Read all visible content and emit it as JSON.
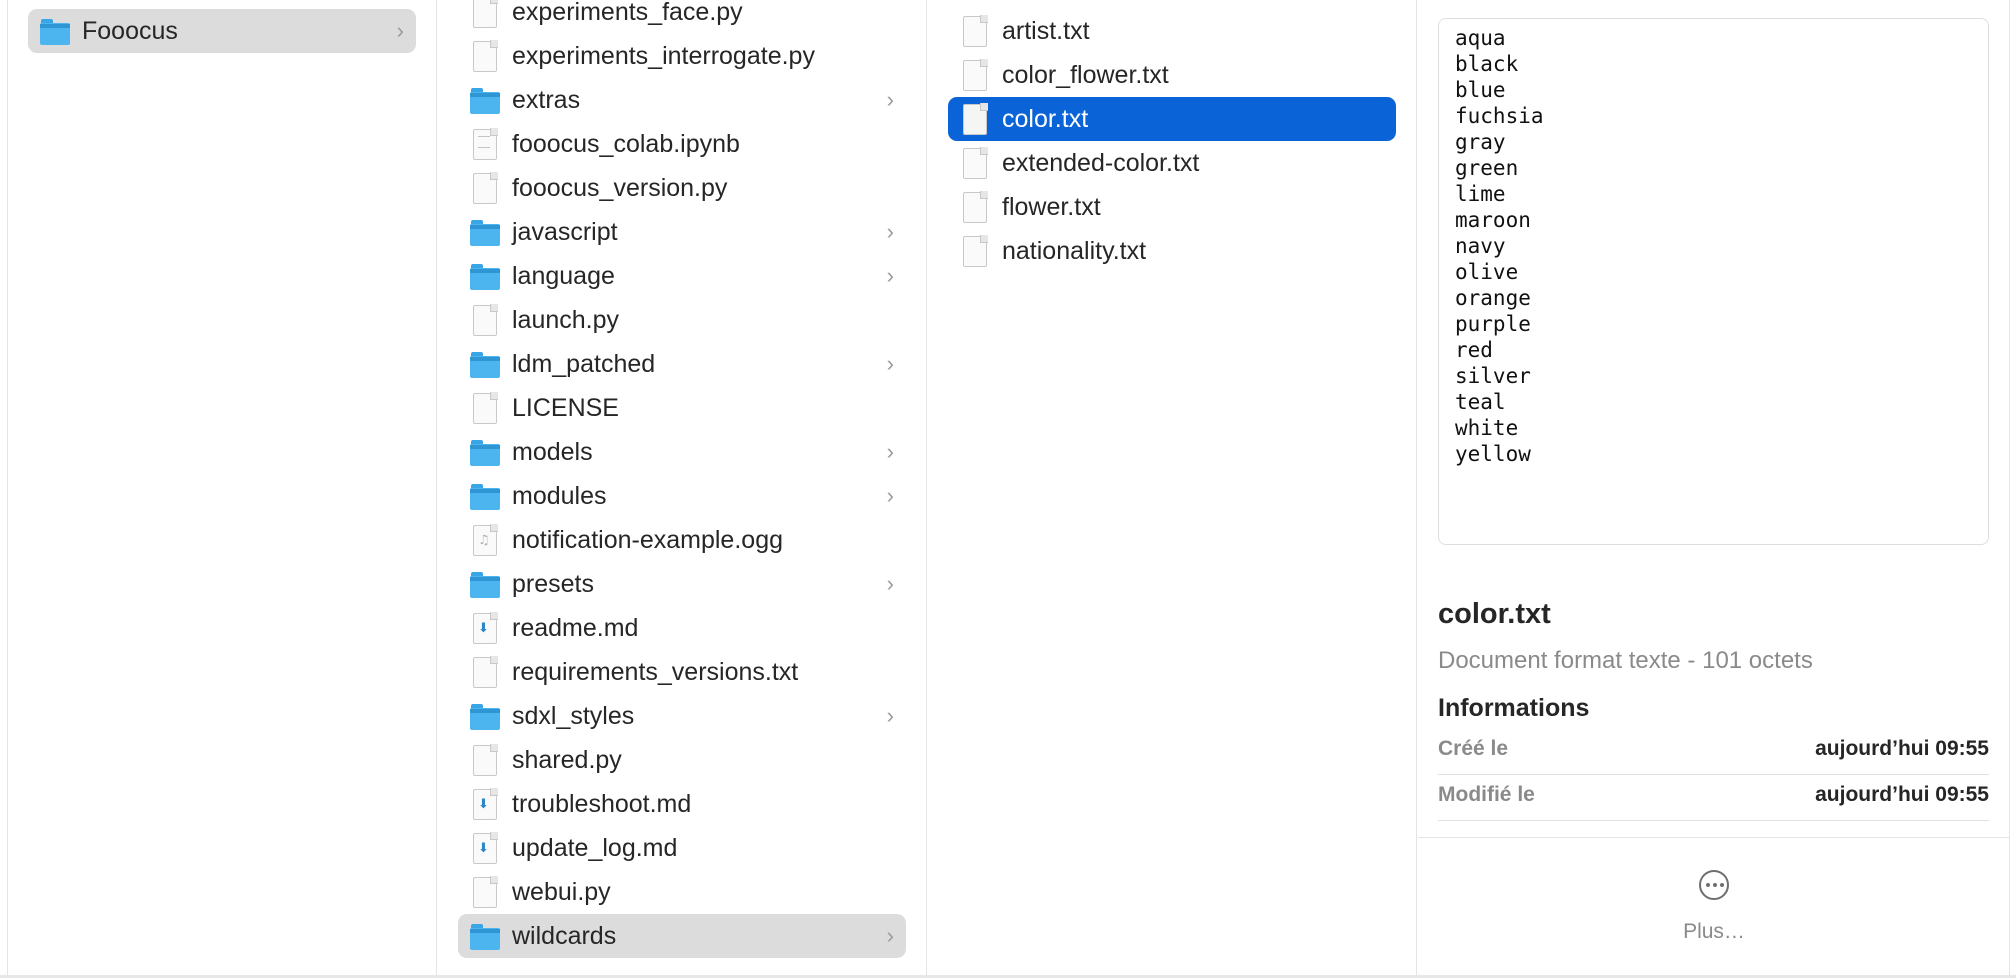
{
  "column1": {
    "items": [
      {
        "name": "Fooocus",
        "icon": "folder-icon",
        "has_children": true,
        "selected": "gray"
      }
    ]
  },
  "column2": {
    "items": [
      {
        "name": "experiments_face.py",
        "icon": "python-file-icon",
        "tag": "PYTHON"
      },
      {
        "name": "experiments_interrogate.py",
        "icon": "python-file-icon",
        "tag": "PYTHON"
      },
      {
        "name": "extras",
        "icon": "folder-icon",
        "has_children": true
      },
      {
        "name": "fooocus_colab.ipynb",
        "icon": "notebook-file-icon"
      },
      {
        "name": "fooocus_version.py",
        "icon": "python-file-icon",
        "tag": "PYTHON"
      },
      {
        "name": "javascript",
        "icon": "folder-icon",
        "has_children": true
      },
      {
        "name": "language",
        "icon": "folder-icon",
        "has_children": true
      },
      {
        "name": "launch.py",
        "icon": "python-file-icon",
        "tag": "PYTHON"
      },
      {
        "name": "ldm_patched",
        "icon": "folder-icon",
        "has_children": true
      },
      {
        "name": "LICENSE",
        "icon": "text-file-icon",
        "tag": "TXT"
      },
      {
        "name": "models",
        "icon": "folder-icon",
        "has_children": true
      },
      {
        "name": "modules",
        "icon": "folder-icon",
        "has_children": true
      },
      {
        "name": "notification-example.ogg",
        "icon": "audio-file-icon"
      },
      {
        "name": "presets",
        "icon": "folder-icon",
        "has_children": true
      },
      {
        "name": "readme.md",
        "icon": "markdown-file-icon"
      },
      {
        "name": "requirements_versions.txt",
        "icon": "text-file-icon",
        "tag": "TXT"
      },
      {
        "name": "sdxl_styles",
        "icon": "folder-icon",
        "has_children": true
      },
      {
        "name": "shared.py",
        "icon": "python-file-icon",
        "tag": "PYTHON"
      },
      {
        "name": "troubleshoot.md",
        "icon": "markdown-file-icon"
      },
      {
        "name": "update_log.md",
        "icon": "markdown-file-icon"
      },
      {
        "name": "webui.py",
        "icon": "python-file-icon",
        "tag": "PYTHON"
      },
      {
        "name": "wildcards",
        "icon": "folder-icon",
        "has_children": true,
        "selected": "gray"
      }
    ]
  },
  "column3": {
    "items": [
      {
        "name": "artist.txt",
        "icon": "text-file-icon",
        "tag": "TXT"
      },
      {
        "name": "color_flower.txt",
        "icon": "text-file-icon",
        "tag": "TXT"
      },
      {
        "name": "color.txt",
        "icon": "text-file-icon",
        "tag": "TXT",
        "selected": "blue"
      },
      {
        "name": "extended-color.txt",
        "icon": "text-file-icon",
        "tag": "TXT"
      },
      {
        "name": "flower.txt",
        "icon": "text-file-icon",
        "tag": "TXT"
      },
      {
        "name": "nationality.txt",
        "icon": "text-file-icon",
        "tag": "TXT"
      }
    ]
  },
  "preview": {
    "content": "aqua\nblack\nblue\nfuchsia\ngray\ngreen\nlime\nmaroon\nnavy\nolive\norange\npurple\nred\nsilver\nteal\nwhite\nyellow",
    "file_name": "color.txt",
    "file_kind": "Document format texte - 101 octets",
    "info_heading": "Informations",
    "info": [
      {
        "label": "Créé le",
        "value": "aujourd’hui 09:55"
      },
      {
        "label": "Modifié le",
        "value": "aujourd’hui 09:55"
      }
    ],
    "more_label": "Plus…"
  },
  "colors": {
    "selection_blue": "#0a64d8",
    "selection_gray": "#dcdcdc",
    "folder_blue": "#4cb5f0"
  }
}
